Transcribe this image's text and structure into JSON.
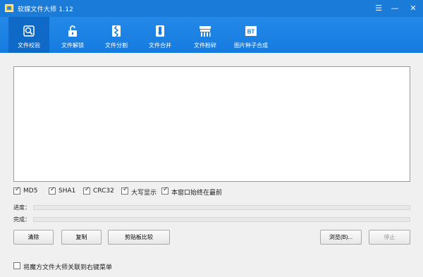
{
  "window": {
    "title": "软媒文件大师 1.12",
    "controls": [
      "☰",
      "—",
      "✕"
    ]
  },
  "toolbar": {
    "items": [
      {
        "label": "文件校验",
        "icon": "file-check-icon",
        "active": true
      },
      {
        "label": "文件解锁",
        "icon": "unlock-icon",
        "active": false
      },
      {
        "label": "文件分割",
        "icon": "split-icon",
        "active": false
      },
      {
        "label": "文件合并",
        "icon": "merge-icon",
        "active": false
      },
      {
        "label": "文件粉碎",
        "icon": "shred-icon",
        "active": false
      },
      {
        "label": "图片种子合成",
        "icon": "bt-image-icon",
        "active": false
      }
    ]
  },
  "options": {
    "md5": {
      "label": "MD5",
      "checked": true
    },
    "sha1": {
      "label": "SHA1",
      "checked": true
    },
    "crc32": {
      "label": "CRC32",
      "checked": true
    },
    "uppercase": {
      "label": "大写显示",
      "checked": true
    },
    "topmost": {
      "label": "本窗口始终在最前",
      "checked": true
    }
  },
  "progress": {
    "progress_label": "进度：",
    "progress_value": 0,
    "complete_label": "完成：",
    "complete_value": 0
  },
  "buttons": {
    "clear": "清除",
    "copy": "复制",
    "clipboard_compare": "剪贴板比较",
    "browse": "浏览(B)...",
    "stop": "停止"
  },
  "context_menu": {
    "label": "将魔方文件大师关联到右键菜单",
    "checked": false
  },
  "colors": {
    "accent": "#1b7bd8",
    "active_tab": "#0f69c7"
  }
}
